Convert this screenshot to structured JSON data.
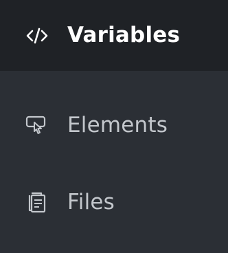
{
  "nav": {
    "items": [
      {
        "label": "Variables",
        "icon": "code-icon",
        "active": true
      },
      {
        "label": "Elements",
        "icon": "pointer-element-icon",
        "active": false
      },
      {
        "label": "Files",
        "icon": "files-icon",
        "active": false
      }
    ]
  },
  "colors": {
    "background": "#2b2f35",
    "active_background": "#1f2226",
    "active_text": "#ffffff",
    "inactive_text": "#c3c7cc"
  }
}
